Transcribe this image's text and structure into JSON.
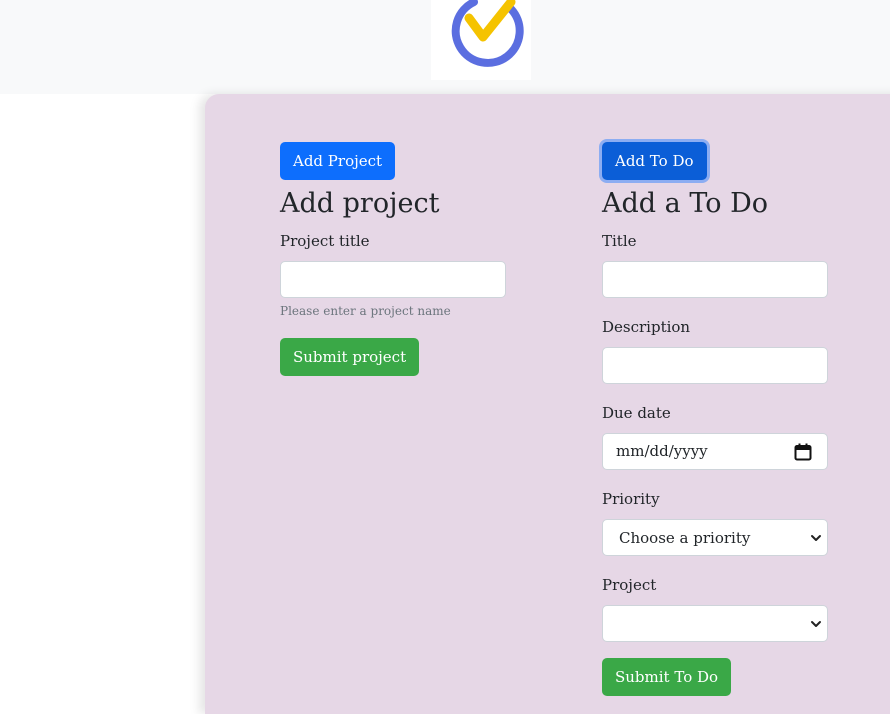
{
  "project_section": {
    "toggle_button": "Add Project",
    "heading": "Add project",
    "title_label": "Project title",
    "title_value": "",
    "title_help": "Please enter a project name",
    "submit_button": "Submit project"
  },
  "todo_section": {
    "toggle_button": "Add To Do",
    "heading": "Add a To Do",
    "title_label": "Title",
    "title_value": "",
    "description_label": "Description",
    "description_value": "",
    "due_date_label": "Due date",
    "due_date_placeholder": "mm/dd/yyyy",
    "priority_label": "Priority",
    "priority_selected": "Choose a priority",
    "project_label": "Project",
    "project_selected": "",
    "submit_button": "Submit To Do"
  },
  "colors": {
    "header_bg": "#f8f9fa",
    "panel_bg": "#e6d7e6",
    "primary": "#0d6efd",
    "success": "#3aa847",
    "logo_ring": "#5b6ee0",
    "logo_check": "#f5c300"
  },
  "icons": {
    "logo": "checkmark-circle-logo",
    "date": "calendar-icon",
    "select": "chevron-down-icon"
  }
}
